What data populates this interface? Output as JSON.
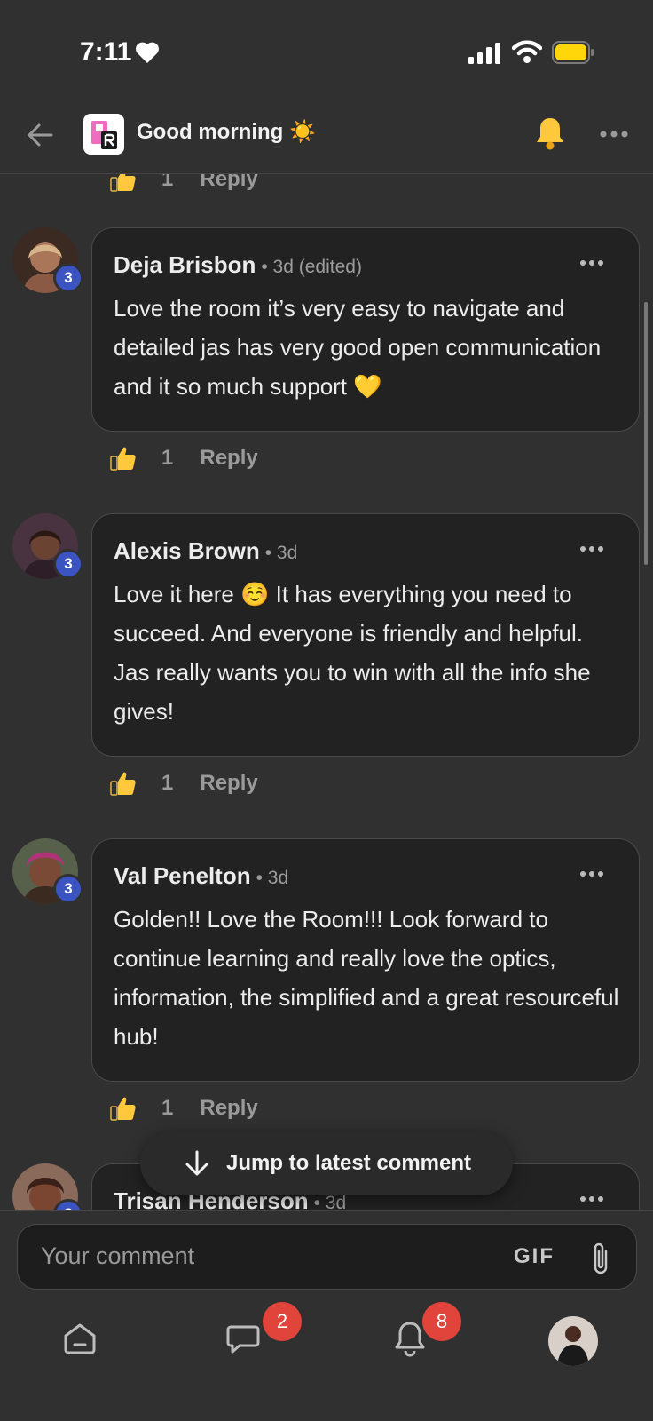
{
  "status_bar": {
    "time": "7:11"
  },
  "header": {
    "title": "Good morning ☀️"
  },
  "first_actions": {
    "likes": "1",
    "reply_label": "Reply"
  },
  "comments": [
    {
      "author": "Deja Brisbon",
      "meta": "• 3d (edited)",
      "level": "3",
      "text": "Love the room it’s very easy to navigate and detailed jas has very good open communication and it so much support 💛",
      "likes": "1",
      "reply_label": "Reply"
    },
    {
      "author": "Alexis Brown",
      "meta": "• 3d",
      "level": "3",
      "text": "Love it here ☺️ It has everything you need to succeed. And everyone is friendly and helpful. Jas really wants you to win with all the info she gives!",
      "likes": "1",
      "reply_label": "Reply"
    },
    {
      "author": "Val Penelton",
      "meta": "• 3d",
      "level": "3",
      "text": "Golden!! Love the Room!!! Look forward to continue learning and really love the optics, information, the simplified and a great resourceful hub!",
      "likes": "1",
      "reply_label": "Reply"
    },
    {
      "author": "Trisan Henderson",
      "meta": "• 3d",
      "level": "3"
    }
  ],
  "jump_button": {
    "label": "Jump to latest comment"
  },
  "composer": {
    "placeholder": "Your comment",
    "gif_label": "GIF"
  },
  "nav": {
    "chat_badge": "2",
    "notifications_badge": "8"
  },
  "colors": {
    "background": "#303030",
    "card": "#222222",
    "level_badge": "#3c54c2",
    "notification_badge": "#e0443a",
    "battery": "#ffd60a"
  }
}
